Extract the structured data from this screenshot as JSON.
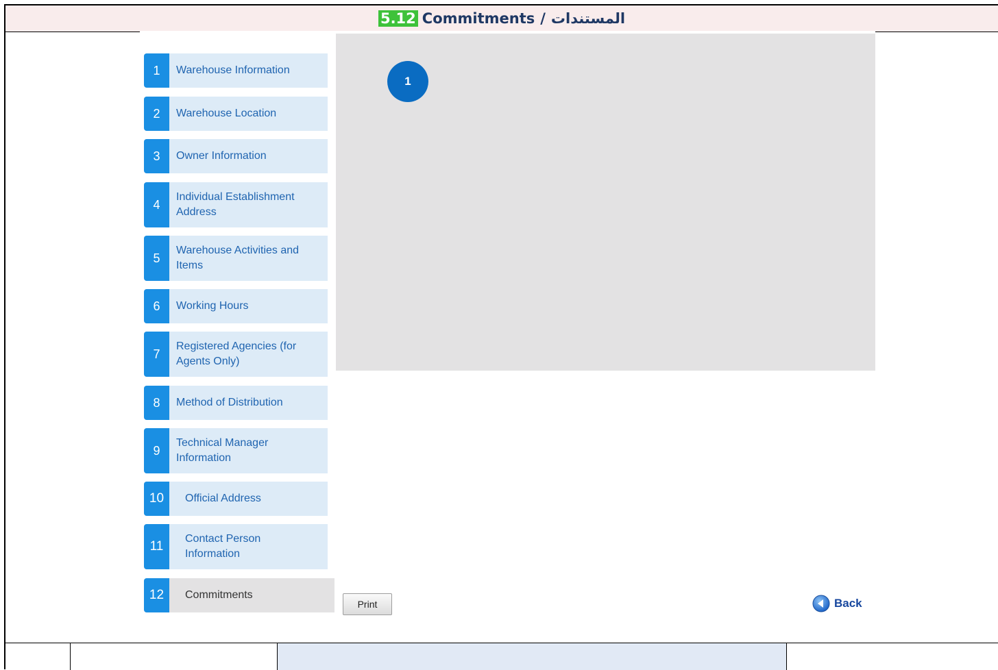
{
  "title": {
    "number": "5.12",
    "english": "Commitments",
    "separator": "/",
    "arabic": "المستندات"
  },
  "nav": {
    "items": [
      {
        "num": "1",
        "label": "Warehouse Information"
      },
      {
        "num": "2",
        "label": "Warehouse Location"
      },
      {
        "num": "3",
        "label": "Owner Information"
      },
      {
        "num": "4",
        "label": "Individual Establishment Address"
      },
      {
        "num": "5",
        "label": "Warehouse Activities and Items"
      },
      {
        "num": "6",
        "label": "Working Hours"
      },
      {
        "num": "7",
        "label": "Registered Agencies (for Agents Only)"
      },
      {
        "num": "8",
        "label": "Method of Distribution"
      },
      {
        "num": "9",
        "label": "Technical Manager Information"
      },
      {
        "num": "10",
        "label": "Official Address"
      },
      {
        "num": "11",
        "label": "Contact Person Information"
      },
      {
        "num": "12",
        "label": "Commitments",
        "active": true
      }
    ]
  },
  "panel": {
    "callout": "1"
  },
  "actions": {
    "print_label": "Print",
    "back_label": "Back",
    "back_icon": "back-arrow-icon"
  },
  "colors": {
    "accent": "#1a8fe3",
    "nav_bg": "#ddebf7",
    "active_bg": "#e3e2e3",
    "title_highlight": "#3ec23a"
  }
}
